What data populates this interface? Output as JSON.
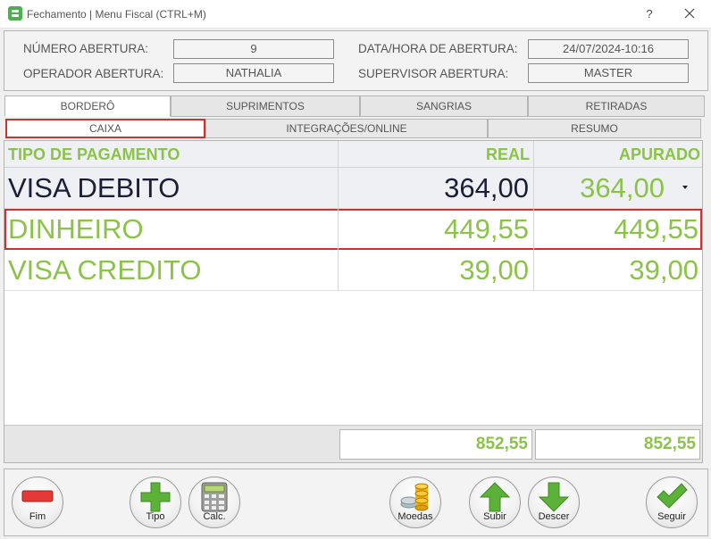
{
  "window": {
    "title": "Fechamento | Menu Fiscal (CTRL+M)",
    "help": "?"
  },
  "header": {
    "numero_abertura_label": "NÚMERO ABERTURA:",
    "numero_abertura_value": "9",
    "operador_label": "OPERADOR ABERTURA:",
    "operador_value": "NATHALIA",
    "data_label": "DATA/HORA DE ABERTURA:",
    "data_value": "24/07/2024-10:16",
    "supervisor_label": "SUPERVISOR ABERTURA:",
    "supervisor_value": "MASTER"
  },
  "tabs": [
    "BORDERÔ",
    "SUPRIMENTOS",
    "SANGRIAS",
    "RETIRADAS"
  ],
  "subtabs": [
    "CAIXA",
    "INTEGRAÇÕES/ONLINE",
    "RESUMO"
  ],
  "grid": {
    "headers": {
      "tipo": "TIPO DE PAGAMENTO",
      "real": "REAL",
      "apurado": "APURADO"
    },
    "rows": [
      {
        "tipo": "VISA DEBITO",
        "real": "364,00",
        "apurado": "364,00"
      },
      {
        "tipo": "DINHEIRO",
        "real": "449,55",
        "apurado": "449,55"
      },
      {
        "tipo": "VISA CREDITO",
        "real": "39,00",
        "apurado": "39,00"
      }
    ],
    "totals": {
      "real": "852,55",
      "apurado": "852,55"
    }
  },
  "toolbar": {
    "fim": "Fim",
    "tipo": "Tipo",
    "calc": "Calc.",
    "moedas": "Moedas",
    "subir": "Subir",
    "descer": "Descer",
    "seguir": "Seguir"
  },
  "colors": {
    "accent_green": "#8bc34a",
    "dark_text": "#1a1f36",
    "highlight_red": "#d32f2f",
    "fim_red": "#e53935"
  }
}
